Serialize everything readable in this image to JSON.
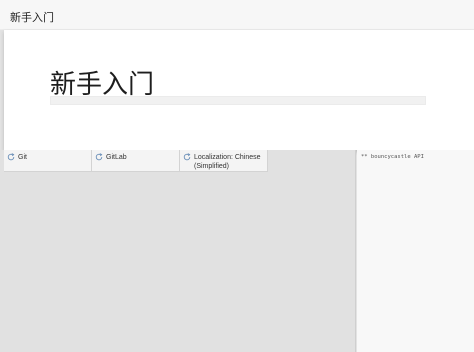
{
  "window": {
    "title": "新手入门"
  },
  "welcome": {
    "heading": "新手入门",
    "progress": 0
  },
  "tabs": [
    {
      "label": "Git",
      "icon": "sync-icon"
    },
    {
      "label": "GitLab",
      "icon": "sync-icon"
    },
    {
      "label": "Localization: Chinese (Simplified)",
      "icon": "sync-icon"
    }
  ],
  "console": {
    "text": "** bouncycastle API"
  }
}
